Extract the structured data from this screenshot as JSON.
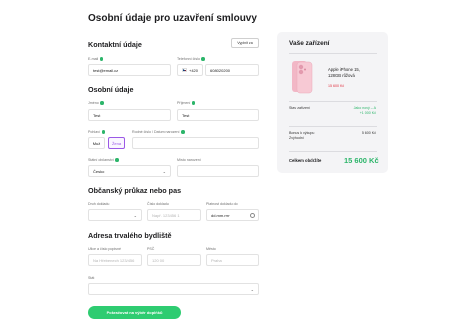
{
  "page": {
    "title": "Osobní údaje pro uzavření smlouvy"
  },
  "contact": {
    "title": "Kontaktní údaje",
    "fill_button": "Vyplnit za",
    "email_label": "E-mail",
    "email_value": "test@email.cz",
    "phone_label": "Telefonní číslo",
    "phone_prefix": "+420",
    "phone_value": "608020200"
  },
  "personal": {
    "title": "Osobní údaje",
    "firstname_label": "Jméno",
    "firstname_value": "Test",
    "lastname_label": "Příjmení",
    "lastname_value": "Test",
    "gender_label": "Pohlaví",
    "gender_options": [
      "Muž",
      "Žena"
    ],
    "gender_selected": "Žena",
    "birthnumber_label": "Rodné číslo / Datum narození",
    "citizenship_label": "Státní občanství",
    "citizenship_value": "Česko",
    "birthplace_label": "Místo narození"
  },
  "id_card": {
    "title": "Občanský průkaz nebo pas",
    "type_label": "Druh dokladu",
    "number_label": "Číslo dokladu",
    "number_placeholder": "Např. 123456 1",
    "validity_label": "Platnost dokladu do",
    "validity_placeholder": "dd.mm.rrrr"
  },
  "address": {
    "title": "Adresa trvalého bydliště",
    "street_label": "Ulice a číslo popisné",
    "street_placeholder": "Na Hřebenech 123/456",
    "zip_label": "PSČ",
    "zip_placeholder": "120 00",
    "city_label": "Město",
    "city_placeholder": "Praha",
    "state_label": "Stát"
  },
  "submit_label": "Pokračovat na výběr doplňků",
  "cart": {
    "title": "Vaše zařízení",
    "product_name": "Apple iPhone 15, 128GB růžová",
    "product_price": "15 600 Kč",
    "rows": [
      {
        "label": "Stav zařízení",
        "value": "Jako nový – A\n+1 000 Kč"
      },
      {
        "label": "Bonus k výkupu\nZvýhodní",
        "value": "5 600 Kč"
      }
    ],
    "total_label": "Celkem obdržíte",
    "total_value": "15 600 Kč"
  },
  "colors": {
    "accent_green": "#2ecc71",
    "selected_purple": "#9b59e6",
    "price_red": "#e0303e",
    "card_bg": "#f4f4f6"
  },
  "icons": [
    "chevron-down-icon",
    "calendar-icon",
    "czech-flag-icon",
    "phone-image"
  ]
}
